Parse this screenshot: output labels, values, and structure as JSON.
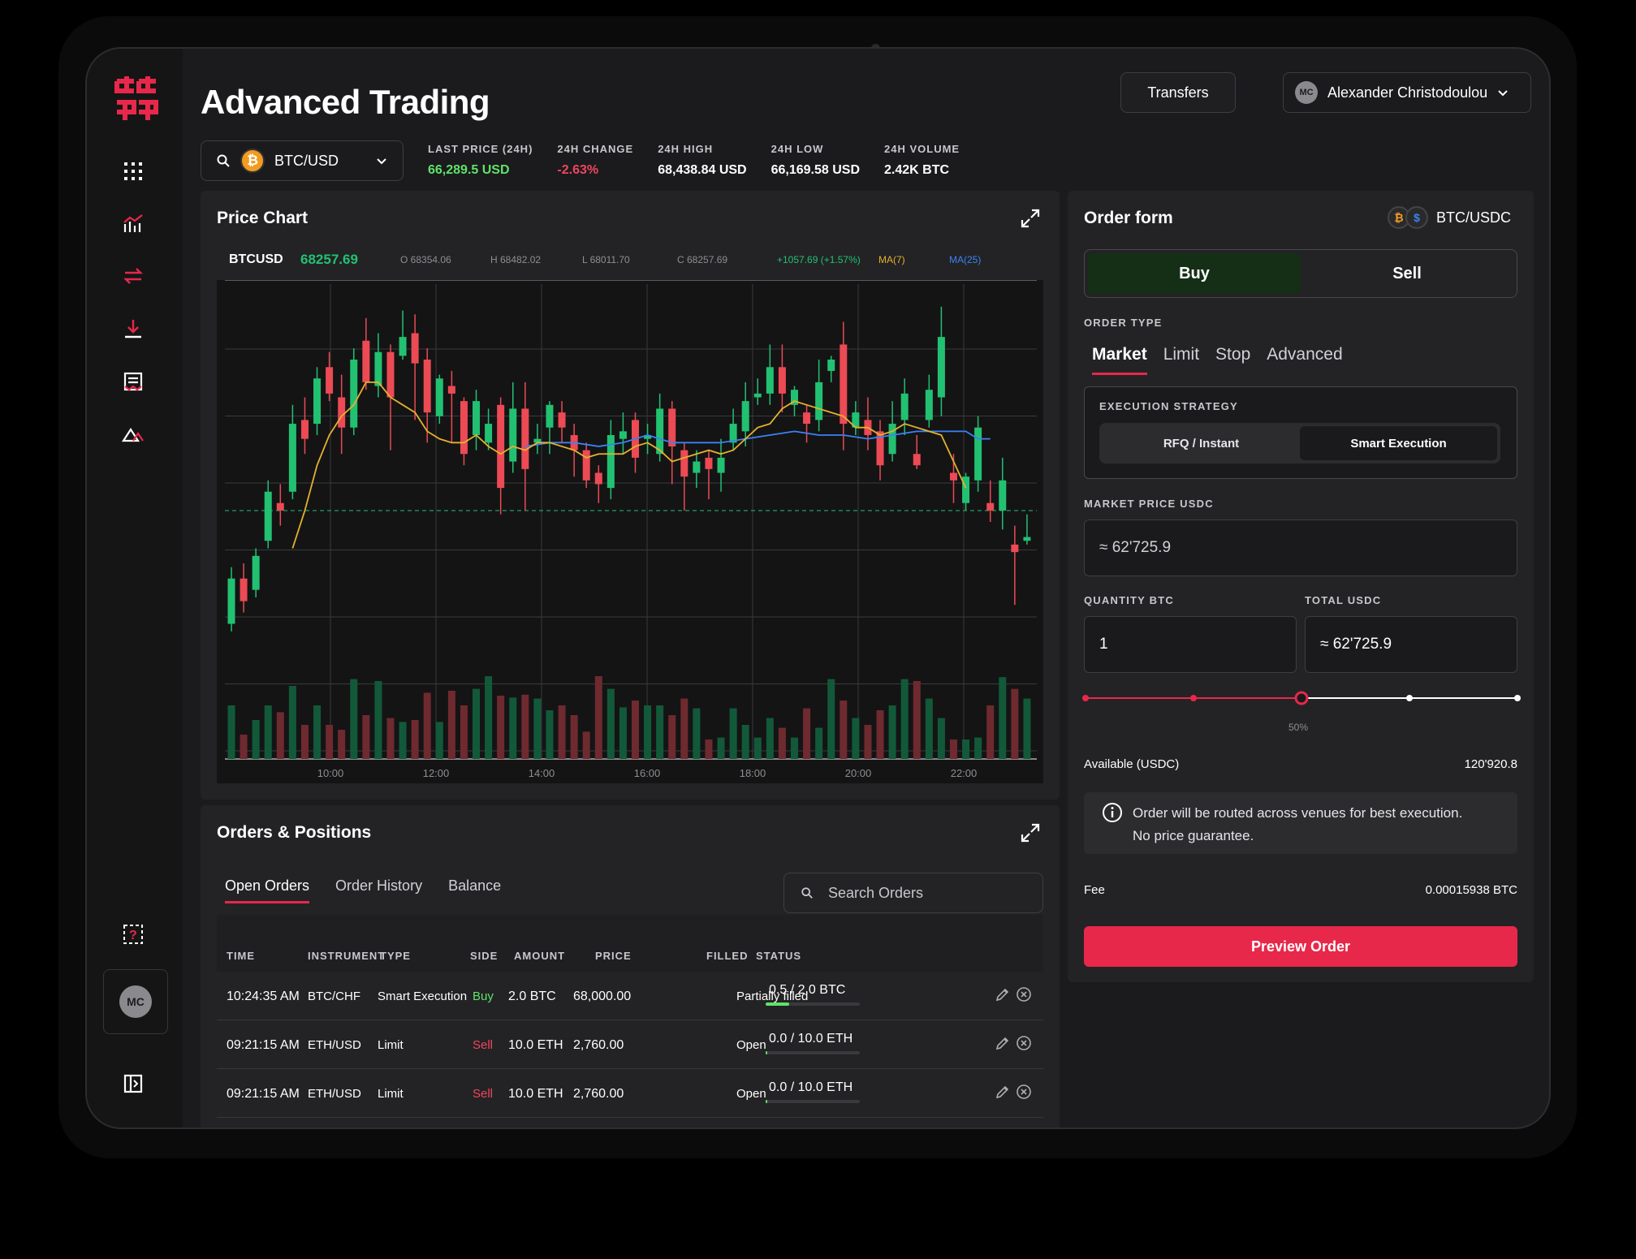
{
  "app": {
    "title": "Advanced Trading"
  },
  "header": {
    "transfers_label": "Transfers",
    "user": {
      "initials": "MC",
      "name": "Alexander Christodoulou"
    }
  },
  "pair": {
    "symbol": "BTC/USD",
    "coin_icon": "bitcoin-icon"
  },
  "stats": [
    {
      "label": "LAST PRICE (24H)",
      "value": "66,289.5 USD",
      "color": "#5ee36a"
    },
    {
      "label": "24H CHANGE",
      "value": "-2.63%",
      "color": "#f0455f"
    },
    {
      "label": "24H HIGH",
      "value": "68,438.84 USD",
      "color": "#ffffff"
    },
    {
      "label": "24H LOW",
      "value": "66,169.58 USD",
      "color": "#ffffff"
    },
    {
      "label": "24H VOLUME",
      "value": "2.42K BTC",
      "color": "#ffffff"
    }
  ],
  "price_chart": {
    "title": "Price Chart",
    "symbol": "BTCUSD",
    "price": "68257.69",
    "open": "O 68354.06",
    "high": "H 68482.02",
    "low": "L 68011.70",
    "close": "C 68257.69",
    "change": "+1057.69 (+1.57%)",
    "ma7": "MA(7)",
    "ma25": "MA(25)"
  },
  "chart_data": {
    "type": "candlestick",
    "x_ticks": [
      "10:00",
      "12:00",
      "14:00",
      "16:00",
      "18:00",
      "20:00",
      "22:00"
    ],
    "candles": [
      {
        "o": 0.1,
        "c": 0.22,
        "h": 0.25,
        "l": 0.08
      },
      {
        "o": 0.22,
        "c": 0.16,
        "h": 0.26,
        "l": 0.13
      },
      {
        "o": 0.19,
        "c": 0.28,
        "h": 0.3,
        "l": 0.17
      },
      {
        "o": 0.32,
        "c": 0.45,
        "h": 0.48,
        "l": 0.3
      },
      {
        "o": 0.42,
        "c": 0.4,
        "h": 0.47,
        "l": 0.36
      },
      {
        "o": 0.45,
        "c": 0.63,
        "h": 0.68,
        "l": 0.43
      },
      {
        "o": 0.64,
        "c": 0.59,
        "h": 0.7,
        "l": 0.55
      },
      {
        "o": 0.63,
        "c": 0.75,
        "h": 0.78,
        "l": 0.6
      },
      {
        "o": 0.78,
        "c": 0.71,
        "h": 0.82,
        "l": 0.69
      },
      {
        "o": 0.7,
        "c": 0.62,
        "h": 0.76,
        "l": 0.55
      },
      {
        "o": 0.62,
        "c": 0.8,
        "h": 0.83,
        "l": 0.6
      },
      {
        "o": 0.85,
        "c": 0.74,
        "h": 0.91,
        "l": 0.72
      },
      {
        "o": 0.73,
        "c": 0.82,
        "h": 0.87,
        "l": 0.7
      },
      {
        "o": 0.82,
        "c": 0.7,
        "h": 0.84,
        "l": 0.56
      },
      {
        "o": 0.81,
        "c": 0.86,
        "h": 0.93,
        "l": 0.8
      },
      {
        "o": 0.87,
        "c": 0.79,
        "h": 0.92,
        "l": 0.64
      },
      {
        "o": 0.8,
        "c": 0.66,
        "h": 0.83,
        "l": 0.58
      },
      {
        "o": 0.65,
        "c": 0.75,
        "h": 0.76,
        "l": 0.63
      },
      {
        "o": 0.73,
        "c": 0.71,
        "h": 0.77,
        "l": 0.58
      },
      {
        "o": 0.69,
        "c": 0.55,
        "h": 0.7,
        "l": 0.52
      },
      {
        "o": 0.6,
        "c": 0.69,
        "h": 0.72,
        "l": 0.56
      },
      {
        "o": 0.58,
        "c": 0.63,
        "h": 0.67,
        "l": 0.56
      },
      {
        "o": 0.68,
        "c": 0.46,
        "h": 0.7,
        "l": 0.39
      },
      {
        "o": 0.53,
        "c": 0.67,
        "h": 0.74,
        "l": 0.5
      },
      {
        "o": 0.67,
        "c": 0.51,
        "h": 0.74,
        "l": 0.4
      },
      {
        "o": 0.58,
        "c": 0.59,
        "h": 0.63,
        "l": 0.55
      },
      {
        "o": 0.62,
        "c": 0.68,
        "h": 0.69,
        "l": 0.55
      },
      {
        "o": 0.66,
        "c": 0.62,
        "h": 0.69,
        "l": 0.58
      },
      {
        "o": 0.6,
        "c": 0.56,
        "h": 0.63,
        "l": 0.49
      },
      {
        "o": 0.56,
        "c": 0.48,
        "h": 0.58,
        "l": 0.46
      },
      {
        "o": 0.5,
        "c": 0.47,
        "h": 0.52,
        "l": 0.42
      },
      {
        "o": 0.46,
        "c": 0.6,
        "h": 0.64,
        "l": 0.43
      },
      {
        "o": 0.59,
        "c": 0.61,
        "h": 0.66,
        "l": 0.55
      },
      {
        "o": 0.64,
        "c": 0.54,
        "h": 0.66,
        "l": 0.5
      },
      {
        "o": 0.59,
        "c": 0.6,
        "h": 0.63,
        "l": 0.55
      },
      {
        "o": 0.55,
        "c": 0.67,
        "h": 0.71,
        "l": 0.53
      },
      {
        "o": 0.67,
        "c": 0.57,
        "h": 0.69,
        "l": 0.47
      },
      {
        "o": 0.56,
        "c": 0.49,
        "h": 0.58,
        "l": 0.4
      },
      {
        "o": 0.5,
        "c": 0.53,
        "h": 0.56,
        "l": 0.46
      },
      {
        "o": 0.54,
        "c": 0.51,
        "h": 0.56,
        "l": 0.43
      },
      {
        "o": 0.5,
        "c": 0.54,
        "h": 0.59,
        "l": 0.45
      },
      {
        "o": 0.58,
        "c": 0.63,
        "h": 0.67,
        "l": 0.56
      },
      {
        "o": 0.61,
        "c": 0.69,
        "h": 0.74,
        "l": 0.57
      },
      {
        "o": 0.7,
        "c": 0.71,
        "h": 0.75,
        "l": 0.68
      },
      {
        "o": 0.71,
        "c": 0.78,
        "h": 0.84,
        "l": 0.68
      },
      {
        "o": 0.78,
        "c": 0.71,
        "h": 0.84,
        "l": 0.66
      },
      {
        "o": 0.68,
        "c": 0.72,
        "h": 0.73,
        "l": 0.65
      },
      {
        "o": 0.66,
        "c": 0.63,
        "h": 0.68,
        "l": 0.58
      },
      {
        "o": 0.64,
        "c": 0.74,
        "h": 0.8,
        "l": 0.61
      },
      {
        "o": 0.77,
        "c": 0.8,
        "h": 0.81,
        "l": 0.74
      },
      {
        "o": 0.84,
        "c": 0.63,
        "h": 0.9,
        "l": 0.56
      },
      {
        "o": 0.62,
        "c": 0.66,
        "h": 0.69,
        "l": 0.6
      },
      {
        "o": 0.64,
        "c": 0.6,
        "h": 0.7,
        "l": 0.56
      },
      {
        "o": 0.61,
        "c": 0.52,
        "h": 0.64,
        "l": 0.48
      },
      {
        "o": 0.55,
        "c": 0.63,
        "h": 0.69,
        "l": 0.53
      },
      {
        "o": 0.64,
        "c": 0.71,
        "h": 0.75,
        "l": 0.6
      },
      {
        "o": 0.55,
        "c": 0.52,
        "h": 0.6,
        "l": 0.51
      },
      {
        "o": 0.64,
        "c": 0.72,
        "h": 0.76,
        "l": 0.62
      },
      {
        "o": 0.7,
        "c": 0.86,
        "h": 0.94,
        "l": 0.65
      },
      {
        "o": 0.5,
        "c": 0.48,
        "h": 0.55,
        "l": 0.42
      },
      {
        "o": 0.42,
        "c": 0.49,
        "h": 0.5,
        "l": 0.4
      },
      {
        "o": 0.48,
        "c": 0.62,
        "h": 0.65,
        "l": 0.45
      },
      {
        "o": 0.42,
        "c": 0.4,
        "h": 0.48,
        "l": 0.37
      },
      {
        "o": 0.4,
        "c": 0.48,
        "h": 0.54,
        "l": 0.35
      },
      {
        "o": 0.31,
        "c": 0.29,
        "h": 0.36,
        "l": 0.15
      },
      {
        "o": 0.32,
        "c": 0.33,
        "h": 0.39,
        "l": 0.31
      }
    ],
    "volumes": [
      0.55,
      0.25,
      0.4,
      0.55,
      0.48,
      0.75,
      0.35,
      0.55,
      0.35,
      0.3,
      0.82,
      0.45,
      0.8,
      0.42,
      0.38,
      0.4,
      0.68,
      0.38,
      0.7,
      0.55,
      0.72,
      0.85,
      0.65,
      0.63,
      0.66,
      0.62,
      0.5,
      0.55,
      0.45,
      0.28,
      0.85,
      0.72,
      0.53,
      0.6,
      0.55,
      0.55,
      0.45,
      0.62,
      0.52,
      0.2,
      0.22,
      0.52,
      0.35,
      0.22,
      0.42,
      0.32,
      0.22,
      0.52,
      0.32,
      0.82,
      0.6,
      0.42,
      0.35,
      0.5,
      0.55,
      0.82,
      0.8,
      0.62,
      0.42,
      0.2,
      0.2,
      0.22,
      0.55,
      0.84,
      0.72,
      0.62,
      0.5,
      0.62
    ],
    "ma7": [
      [
        5,
        0.3
      ],
      [
        6,
        0.4
      ],
      [
        7,
        0.52
      ],
      [
        8,
        0.6
      ],
      [
        9,
        0.65
      ],
      [
        10,
        0.68
      ],
      [
        11,
        0.74
      ],
      [
        12,
        0.74
      ],
      [
        13,
        0.7
      ],
      [
        14,
        0.68
      ],
      [
        15,
        0.66
      ],
      [
        16,
        0.61
      ],
      [
        17,
        0.59
      ],
      [
        18,
        0.58
      ],
      [
        19,
        0.58
      ],
      [
        20,
        0.6
      ],
      [
        21,
        0.57
      ],
      [
        22,
        0.55
      ],
      [
        23,
        0.57
      ],
      [
        24,
        0.56
      ],
      [
        25,
        0.58
      ],
      [
        26,
        0.58
      ],
      [
        27,
        0.57
      ],
      [
        28,
        0.56
      ],
      [
        29,
        0.54
      ],
      [
        30,
        0.55
      ],
      [
        31,
        0.55
      ],
      [
        32,
        0.55
      ],
      [
        33,
        0.57
      ],
      [
        34,
        0.58
      ],
      [
        35,
        0.56
      ],
      [
        36,
        0.53
      ],
      [
        37,
        0.54
      ],
      [
        38,
        0.55
      ],
      [
        39,
        0.56
      ],
      [
        40,
        0.55
      ],
      [
        41,
        0.56
      ],
      [
        42,
        0.59
      ],
      [
        43,
        0.62
      ],
      [
        44,
        0.63
      ],
      [
        45,
        0.67
      ],
      [
        46,
        0.69
      ],
      [
        47,
        0.68
      ],
      [
        48,
        0.67
      ],
      [
        49,
        0.66
      ],
      [
        50,
        0.65
      ],
      [
        51,
        0.62
      ],
      [
        52,
        0.62
      ],
      [
        53,
        0.6
      ],
      [
        54,
        0.61
      ],
      [
        55,
        0.63
      ],
      [
        56,
        0.62
      ],
      [
        57,
        0.61
      ],
      [
        58,
        0.6
      ],
      [
        59,
        0.53
      ],
      [
        60,
        0.46
      ]
    ],
    "ma25": [
      [
        24,
        0.57
      ],
      [
        26,
        0.58
      ],
      [
        28,
        0.58
      ],
      [
        30,
        0.57
      ],
      [
        32,
        0.58
      ],
      [
        34,
        0.6
      ],
      [
        36,
        0.58
      ],
      [
        38,
        0.58
      ],
      [
        40,
        0.58
      ],
      [
        42,
        0.59
      ],
      [
        44,
        0.6
      ],
      [
        46,
        0.61
      ],
      [
        48,
        0.6
      ],
      [
        50,
        0.6
      ],
      [
        52,
        0.59
      ],
      [
        54,
        0.6
      ],
      [
        56,
        0.61
      ],
      [
        58,
        0.61
      ],
      [
        60,
        0.61
      ],
      [
        61,
        0.59
      ],
      [
        62,
        0.59
      ]
    ],
    "current_price_level": 0.4
  },
  "order_form": {
    "title": "Order form",
    "pair": "BTC/USDC",
    "buy_label": "Buy",
    "sell_label": "Sell",
    "order_type_label": "ORDER TYPE",
    "order_types": [
      "Market",
      "Limit",
      "Stop",
      "Advanced"
    ],
    "execution_label": "EXECUTION STRATEGY",
    "exec_options": [
      "RFQ / Instant",
      "Smart Execution"
    ],
    "market_price_label": "MARKET PRICE USDC",
    "market_price_value": "≈ 62'725.9",
    "quantity_label": "QUANTITY BTC",
    "quantity_value": "1",
    "total_label": "TOTAL USDC",
    "total_value": "≈ 62'725.9",
    "slider_percent": 0.5,
    "slider_label": "50%",
    "available_label": "Available (USDC)",
    "available_value": "120'920.8",
    "notice_line1": "Order will be routed across venues for best execution.",
    "notice_line2": "No price guarantee.",
    "fee_label": "Fee",
    "fee_value": "0.00015938 BTC",
    "preview_label": "Preview Order"
  },
  "orders": {
    "title": "Orders & Positions",
    "tabs": [
      "Open Orders",
      "Order History",
      "Balance"
    ],
    "search_placeholder": "Search Orders",
    "columns": [
      "TIME",
      "INSTRUMENT",
      "TYPE",
      "SIDE",
      "AMOUNT",
      "PRICE",
      "FILLED",
      "STATUS"
    ],
    "rows": [
      {
        "time": "10:24:35 AM",
        "instrument": "BTC/CHF",
        "type": "Smart Execution",
        "side": "Buy",
        "amount": "2.0 BTC",
        "price": "68,000.00",
        "filled": "0.5 / 2.0 BTC",
        "fill_fraction": 0.25,
        "status": "Partially filled"
      },
      {
        "time": "09:21:15 AM",
        "instrument": "ETH/USD",
        "type": "Limit",
        "side": "Sell",
        "amount": "10.0 ETH",
        "price": "2,760.00",
        "filled": "0.0 / 10.0 ETH",
        "fill_fraction": 0.0,
        "status": "Open"
      },
      {
        "time": "09:21:15 AM",
        "instrument": "ETH/USD",
        "type": "Limit",
        "side": "Sell",
        "amount": "10.0 ETH",
        "price": "2,760.00",
        "filled": "0.0 / 10.0 ETH",
        "fill_fraction": 0.0,
        "status": "Open"
      }
    ]
  },
  "colors": {
    "accent": "#e8284a",
    "green": "#22c172",
    "red": "#ec4a54",
    "buy_bg": "#142f16"
  }
}
